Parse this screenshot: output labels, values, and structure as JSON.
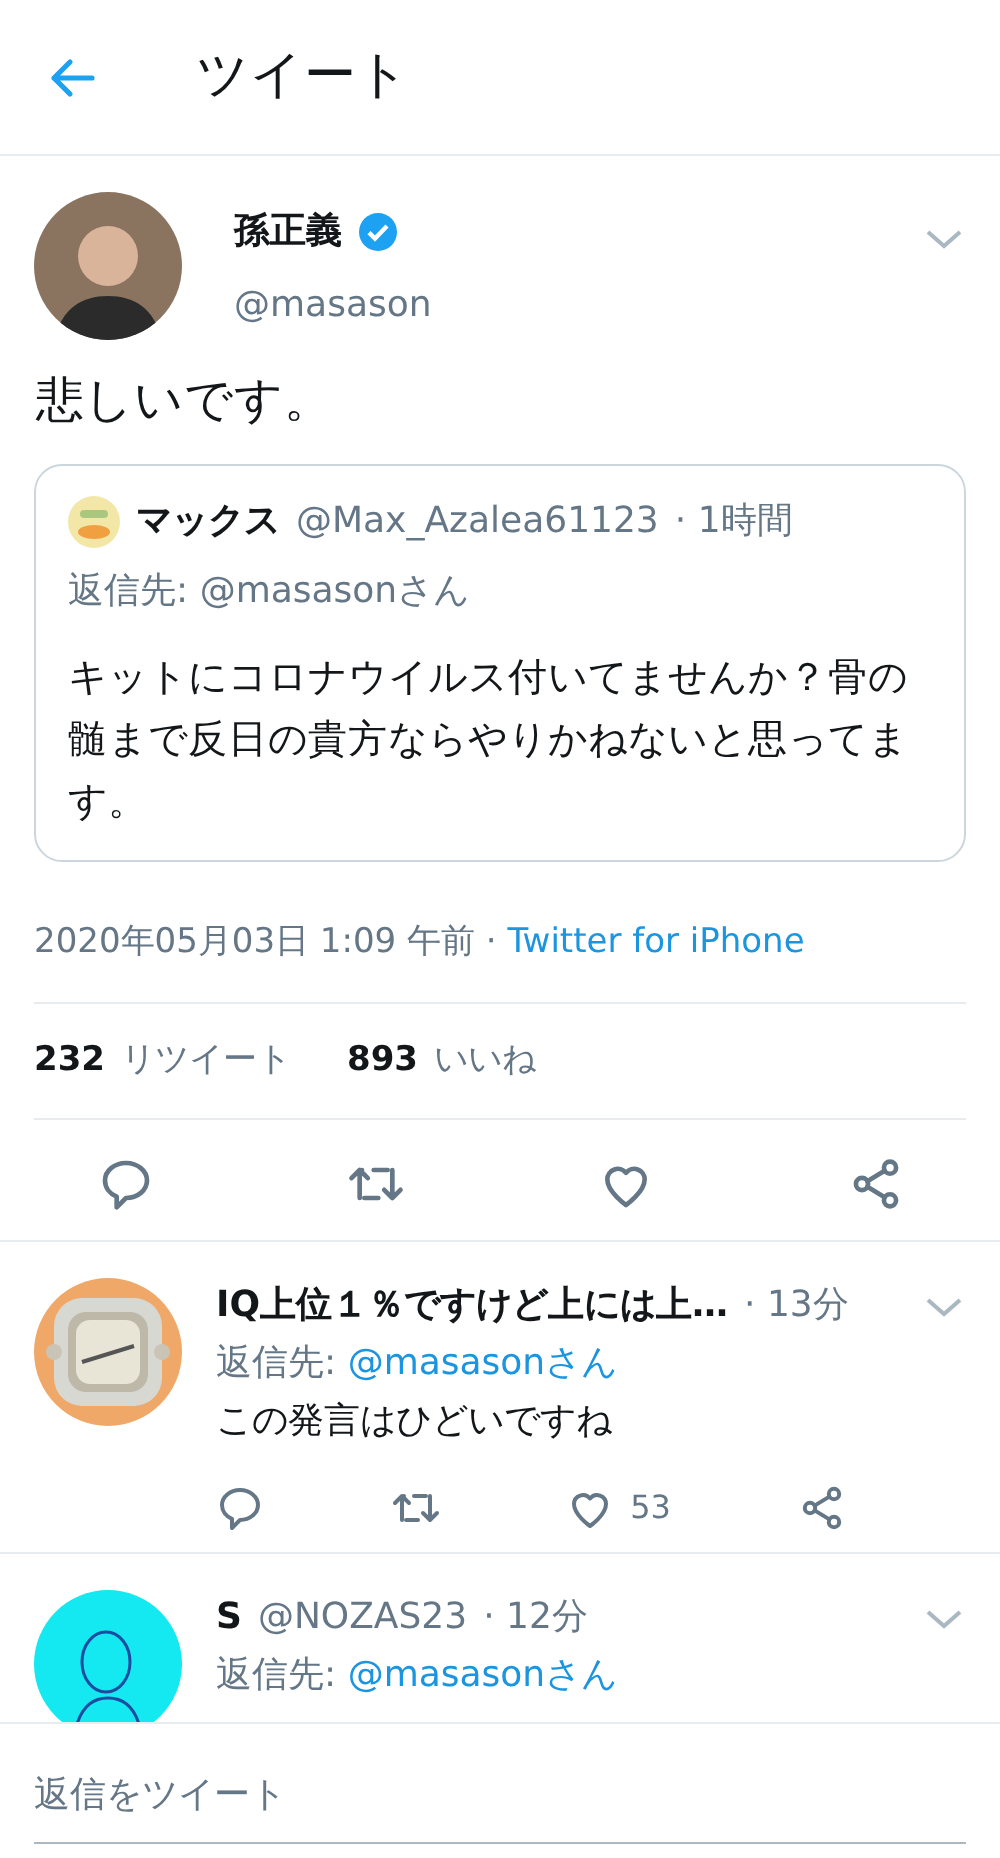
{
  "header": {
    "title": "ツイート"
  },
  "tweet": {
    "author": {
      "name": "孫正義",
      "verified": true,
      "handle": "@masason"
    },
    "text": "悲しいです。",
    "quote": {
      "name": "マックス",
      "handle": "@Max_Azalea61123",
      "time": "· 1時間",
      "reply_label": "返信先:",
      "reply_to": "@masasonさん",
      "text": "キットにコロナウイルス付いてませんか？骨の髄まで反日の貴方ならやりかねないと思ってます。"
    },
    "timestamp": "2020年05月03日 1:09 午前",
    "separator": "·",
    "source": "Twitter for iPhone",
    "stats": [
      {
        "count": "232",
        "label": "リツイート"
      },
      {
        "count": "893",
        "label": "いいね"
      }
    ],
    "actions": [
      {
        "kind": "reply"
      },
      {
        "kind": "retweet"
      },
      {
        "kind": "like"
      },
      {
        "kind": "share"
      }
    ]
  },
  "replies": [
    {
      "name": "IQ上位１％ですけど上には上…",
      "time": "· 13分",
      "reply_label": "返信先:",
      "reply_to": "@masasonさん",
      "text": "この発言はひどいですね",
      "actions": [
        {
          "kind": "reply"
        },
        {
          "kind": "retweet"
        },
        {
          "kind": "like",
          "count": "53"
        },
        {
          "kind": "share"
        }
      ]
    },
    {
      "avatar": {
        "kind": "illustration",
        "color": "#14e8f0"
      },
      "name": "S",
      "handle": "@NOZAS23",
      "time": "· 12分",
      "reply_label": "返信先:",
      "reply_to": "@masasonさん"
    }
  ],
  "reply_bar": {
    "placeholder": "返信をツイート"
  }
}
